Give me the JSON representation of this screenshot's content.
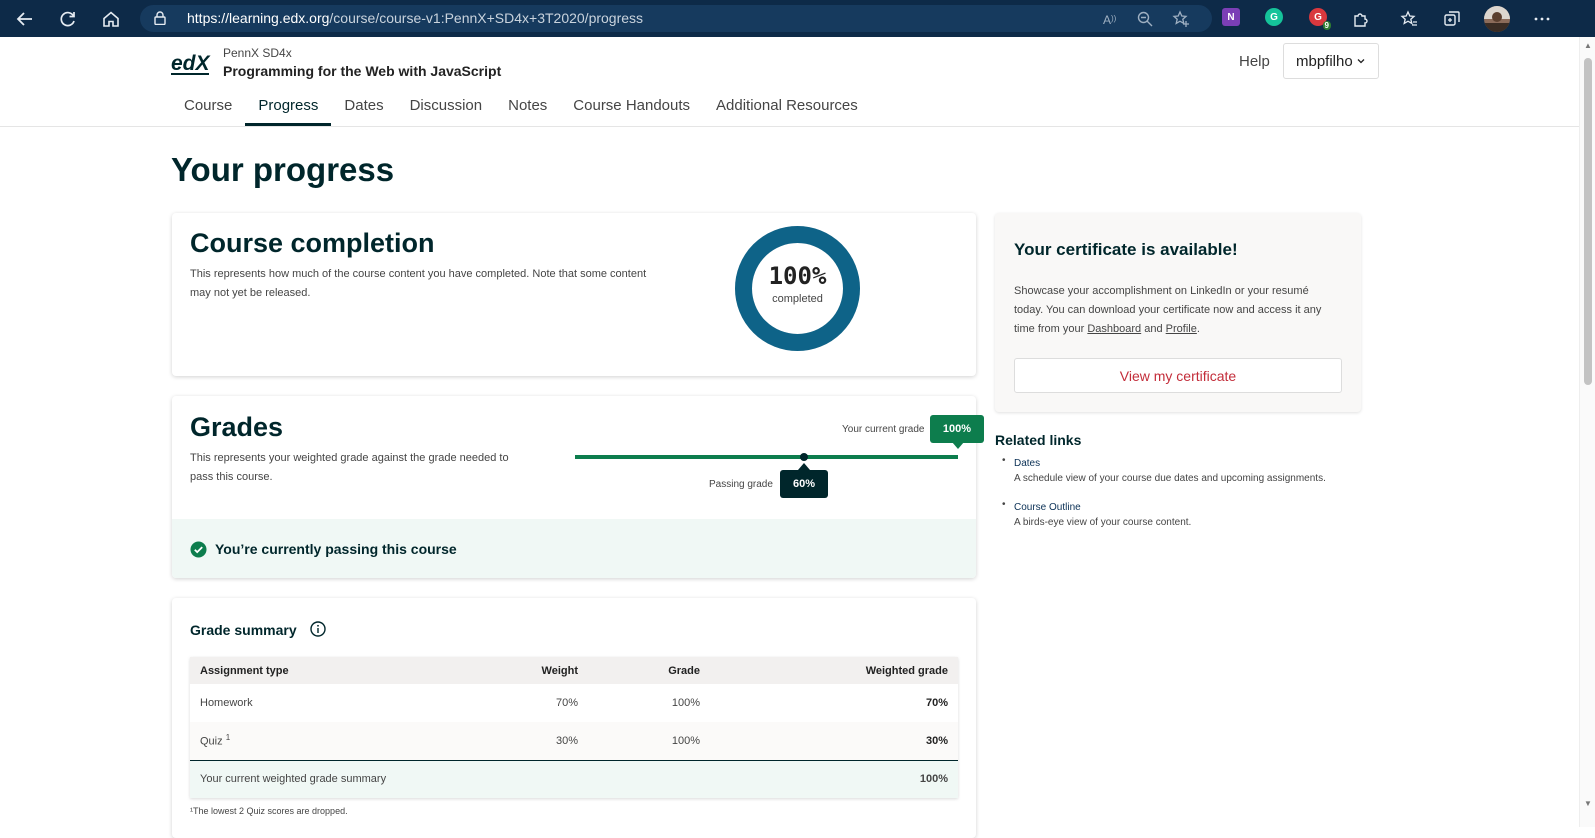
{
  "browser": {
    "url_host": "https://learning.edx.org",
    "url_path": "/course/course-v1:PennX+SD4x+3T2020/progress",
    "extension_badge": "9"
  },
  "header": {
    "logo_text": "edX",
    "org": "PennX SD4x",
    "course_title": "Programming for the Web with JavaScript",
    "help_label": "Help",
    "username": "mbpfilho"
  },
  "tabs": [
    {
      "label": "Course"
    },
    {
      "label": "Progress",
      "active": true
    },
    {
      "label": "Dates"
    },
    {
      "label": "Discussion"
    },
    {
      "label": "Notes"
    },
    {
      "label": "Course Handouts"
    },
    {
      "label": "Additional Resources"
    }
  ],
  "page_title": "Your progress",
  "completion": {
    "title": "Course completion",
    "description": "This represents how much of the course content you have completed. Note that some content may not yet be released.",
    "percent_text": "100%",
    "percent_value": 100,
    "percent_label": "completed"
  },
  "grades": {
    "title": "Grades",
    "description": "This represents your weighted grade against the grade needed to pass this course.",
    "current_grade_label": "Your current grade",
    "current_grade": "100%",
    "current_grade_value": 100,
    "passing_grade_label": "Passing grade",
    "passing_grade": "60%",
    "passing_grade_value": 60,
    "status_text": "You’re currently passing this course"
  },
  "grade_summary": {
    "title": "Grade summary",
    "columns": [
      "Assignment type",
      "Weight",
      "Grade",
      "Weighted grade"
    ],
    "rows": [
      {
        "type": "Homework",
        "footnote": "",
        "weight": "70%",
        "grade": "100%",
        "weighted": "70%"
      },
      {
        "type": "Quiz",
        "footnote": "1",
        "weight": "30%",
        "grade": "100%",
        "weighted": "30%"
      }
    ],
    "total_label": "Your current weighted grade summary",
    "total_value": "100%",
    "footnote_text": "¹The lowest 2 Quiz scores are dropped."
  },
  "certificate": {
    "title": "Your certificate is available!",
    "description_start": "Showcase your accomplishment on LinkedIn or your resumé today. You can download your certificate now and access it any time from your ",
    "dashboard_link": "Dashboard",
    "and_text": " and ",
    "profile_link": "Profile",
    "period": ".",
    "button_label": "View my certificate"
  },
  "related": {
    "title": "Related links",
    "items": [
      {
        "label": "Dates",
        "description": "A schedule view of your course due dates and upcoming assignments."
      },
      {
        "label": "Course Outline",
        "description": "A birds-eye view of your course content."
      }
    ]
  },
  "colors": {
    "brand_dark": "#00262b",
    "progress_ring": "#0e6388",
    "grade_green": "#0d7d4d",
    "link_red": "#c32d3a"
  }
}
